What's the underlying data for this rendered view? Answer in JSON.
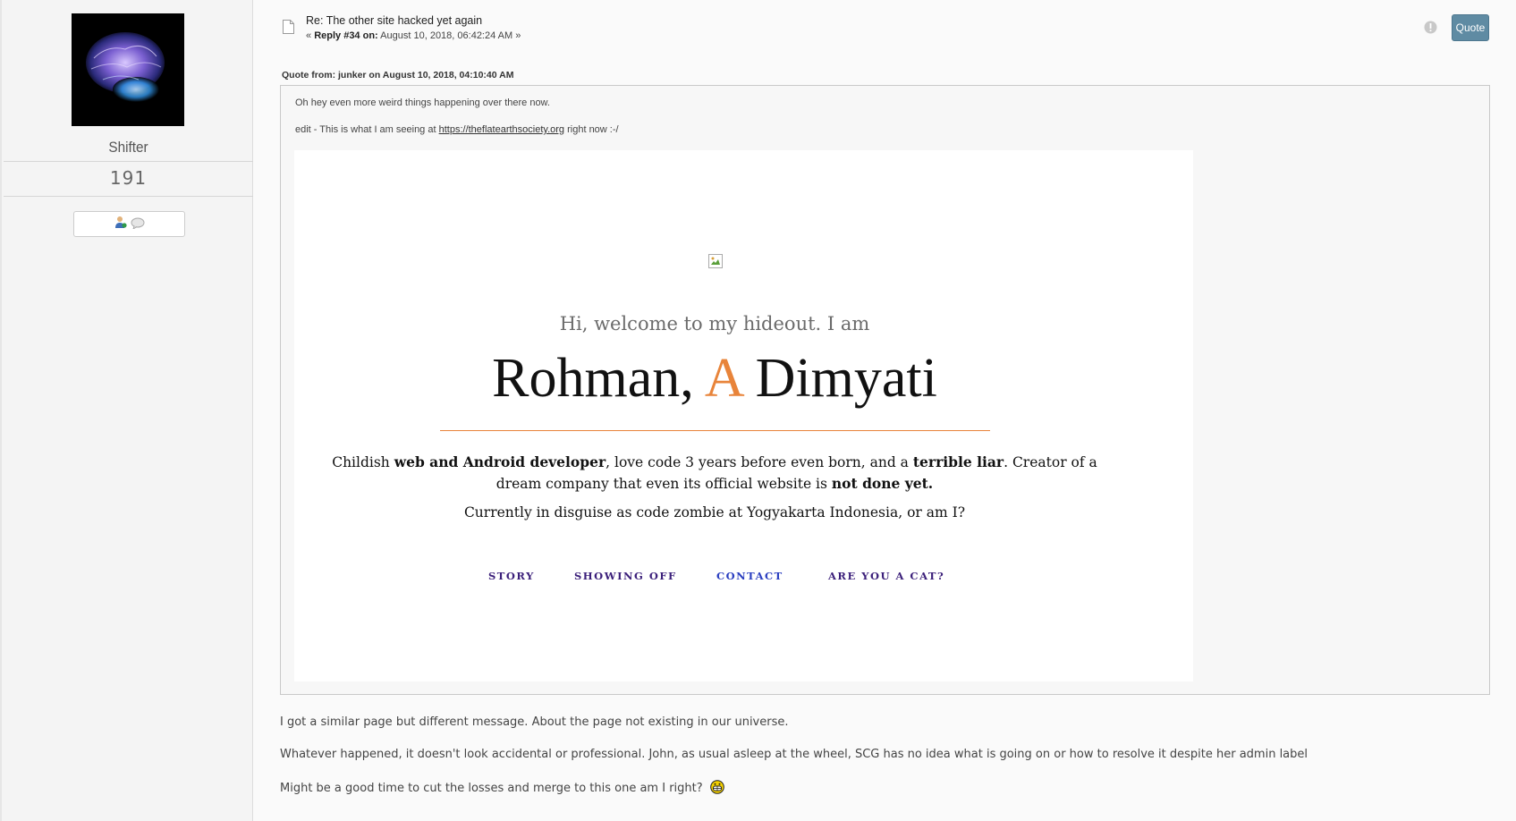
{
  "sidebar": {
    "username": "Shifter",
    "post_count": "191"
  },
  "post": {
    "subject": "Re: The other site hacked yet again",
    "reply_prefix": "«",
    "reply_label": "Reply #34 on:",
    "reply_date": "August 10, 2018, 06:42:24 AM",
    "reply_suffix": "»",
    "quote_button": "Quote"
  },
  "quote": {
    "header": "Quote from: junker on August 10, 2018, 04:10:40 AM",
    "line1": "Oh hey even more weird things happening over there now.",
    "line2_prefix": "edit - This is what I am seeing at",
    "line2_link": "https://theflatearthsociety.org",
    "line2_suffix": "right now :-/"
  },
  "embedded_page": {
    "welcome": "Hi, welcome to my hideout. I am",
    "name_part1": "Rohman,",
    "name_accent": "A",
    "name_part2": "Dimyati",
    "bio_1": "Childish",
    "bio_2": "web and Android developer",
    "bio_3": ", love code 3 years before even born, and a",
    "bio_4": "terrible liar",
    "bio_5": ". Creator of a dream company that even its official website is",
    "bio_6": "not done yet.",
    "location": "Currently in disguise as code zombie at Yogyakarta Indonesia, or am I?",
    "nav": [
      "STORY",
      "SHOWING OFF",
      "CONTACT",
      "ARE YOU A CAT?"
    ],
    "accent_color": "#e8843a"
  },
  "body": {
    "p1": "I got a similar page but different message. About the page not existing in our universe.",
    "p2": "Whatever happened, it doesn't look accidental or professional. John, as usual asleep at the wheel, SCG has no idea what is going on or how to resolve it despite her admin label",
    "p3": "Might be a good time to cut the losses and merge to this one am I right?"
  }
}
